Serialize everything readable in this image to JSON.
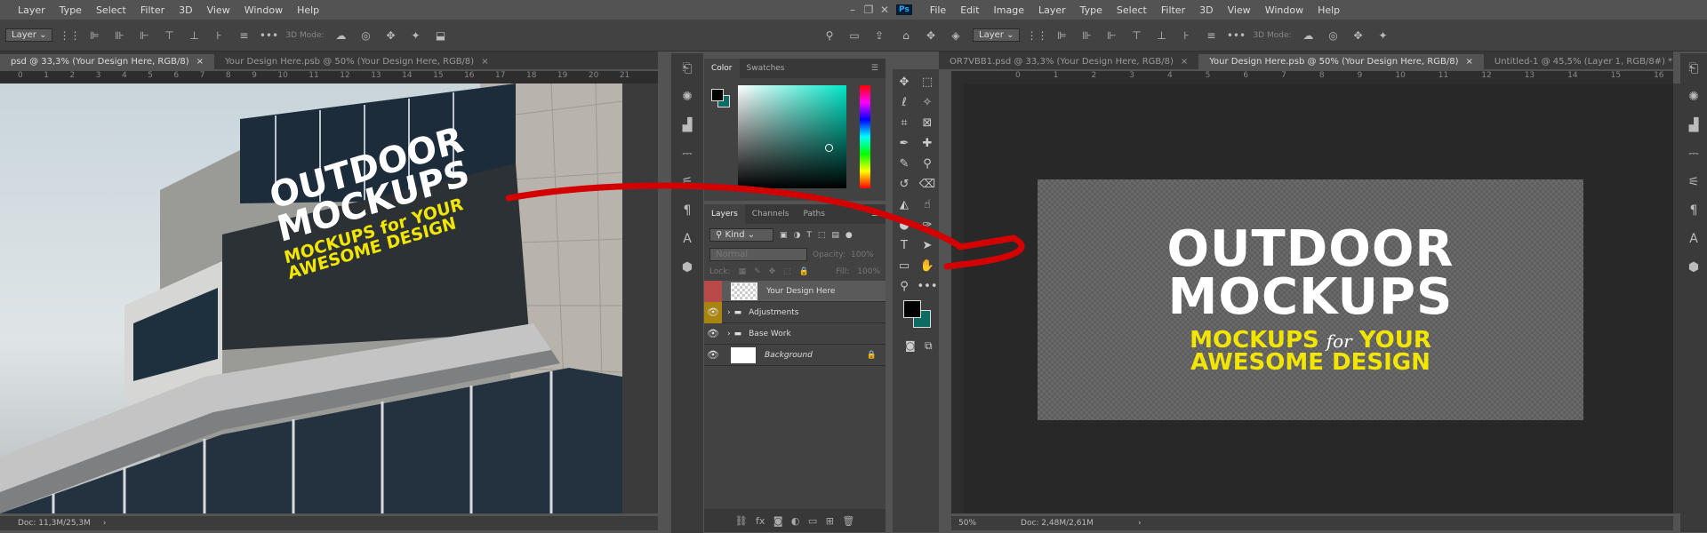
{
  "left": {
    "menu": [
      "Layer",
      "Type",
      "Select",
      "Filter",
      "3D",
      "View",
      "Window",
      "Help"
    ],
    "options": {
      "layer_dropdown": "Layer",
      "mode_3d": "3D Mode:"
    },
    "tabs": [
      {
        "label": "psd @ 33,3% (Your Design Here, RGB/8)",
        "active": true
      },
      {
        "label": "Your Design Here.psb @ 50% (Your Design Here, RGB/8)",
        "active": false
      }
    ],
    "ruler_ticks": [
      "0",
      "1",
      "2",
      "3",
      "4",
      "5",
      "6",
      "7",
      "8",
      "9",
      "10",
      "11",
      "12",
      "13",
      "14",
      "15",
      "16",
      "17",
      "18",
      "19",
      "20",
      "21"
    ],
    "photo_sign": {
      "line1": "OUTDOOR",
      "line2": "MOCKUPS",
      "line3": "MOCKUPS for YOUR",
      "line4": "AWESOME DESIGN"
    },
    "status": {
      "doc": "Doc: 11,3M/25,3M"
    }
  },
  "color_panel": {
    "tabs": [
      "Color",
      "Swatches"
    ],
    "fg": "#000000",
    "bg": "#0e6b63",
    "picker_hue": "#00e6c8"
  },
  "layers_panel": {
    "tabs": [
      "Layers",
      "Channels",
      "Paths"
    ],
    "filter": "Kind",
    "blend": "Normal",
    "opacity_label": "Opacity:",
    "opacity": "100%",
    "lock_label": "Lock:",
    "fill_label": "Fill:",
    "fill": "100%",
    "layers": [
      {
        "name": "Your Design Here",
        "type": "smart",
        "color": "#b84a4a"
      },
      {
        "name": "Adjustments",
        "type": "group",
        "color": "#a8850f"
      },
      {
        "name": "Base Work",
        "type": "group",
        "color": ""
      },
      {
        "name": "Background",
        "type": "bg",
        "color": ""
      }
    ]
  },
  "right": {
    "app_icon": "Ps",
    "menu": [
      "File",
      "Edit",
      "Image",
      "Layer",
      "Type",
      "Select",
      "Filter",
      "3D",
      "View",
      "Window",
      "Help"
    ],
    "options": {
      "layer_dropdown": "Layer",
      "mode_3d": "3D Mode:"
    },
    "tabs": [
      {
        "label": "OR7VBB1.psd @ 33,3% (Your Design Here, RGB/8)",
        "active": false
      },
      {
        "label": "Your Design Here.psb @ 50% (Your Design Here, RGB/8)",
        "active": true
      },
      {
        "label": "Untitled-1 @ 45,5% (Layer 1, RGB/8#) *",
        "active": false
      }
    ],
    "ruler_ticks": [
      "0",
      "1",
      "2",
      "3",
      "4",
      "5",
      "6",
      "7",
      "8",
      "9",
      "10",
      "11",
      "12",
      "13",
      "14",
      "15",
      "16",
      "17",
      "18"
    ],
    "design": {
      "line1": "OUTDOOR",
      "line2": "MOCKUPS",
      "line3a": "MOCKUPS",
      "line3b": "for",
      "line3c": "YOUR",
      "line4": "AWESOME DESIGN"
    },
    "status": {
      "zoom": "50%",
      "doc": "Doc: 2,48M/2,61M"
    },
    "tool_colors": {
      "fg": "#000000",
      "bg": "#0e6b63"
    }
  },
  "colors": {
    "accent_yellow": "#f2e600",
    "arrow_red": "#d40000"
  }
}
